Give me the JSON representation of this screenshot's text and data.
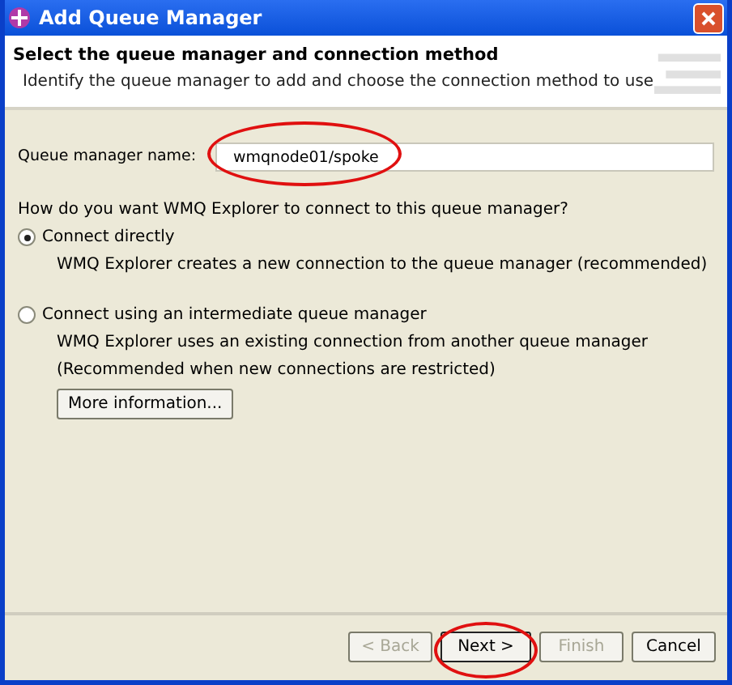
{
  "window": {
    "title": "Add Queue Manager"
  },
  "header": {
    "title": "Select the queue manager and connection method",
    "description": "Identify the queue manager to add and choose the connection method to use"
  },
  "queue_manager_name": {
    "label": "Queue manager name:",
    "value": "wmqnode01/spoke",
    "highlighted": true
  },
  "question": "How do you want WMQ Explorer to connect to this queue manager?",
  "options": [
    {
      "label": "Connect directly",
      "selected": true,
      "description": [
        "WMQ Explorer creates a new connection to the queue manager (recommended)"
      ]
    },
    {
      "label": "Connect using an intermediate queue manager",
      "selected": false,
      "description": [
        "WMQ Explorer uses an existing connection from another queue manager",
        "(Recommended when new connections are restricted)"
      ],
      "button": "More information..."
    }
  ],
  "buttons": [
    {
      "label": "< Back",
      "disabled": true,
      "default": false,
      "highlighted": false
    },
    {
      "label": "Next >",
      "disabled": false,
      "default": true,
      "highlighted": true
    },
    {
      "label": "Finish",
      "disabled": true,
      "default": false,
      "highlighted": false
    },
    {
      "label": "Cancel",
      "disabled": false,
      "default": false,
      "highlighted": false
    }
  ]
}
